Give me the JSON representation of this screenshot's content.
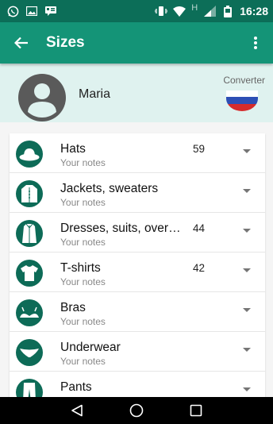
{
  "status_bar": {
    "time": "16:28",
    "network_label": "H",
    "icons": [
      "whatsapp-icon",
      "image-icon",
      "message-icon",
      "vibrate-icon",
      "wifi-icon",
      "signal-icon",
      "battery-icon"
    ]
  },
  "app_bar": {
    "title": "Sizes",
    "back_icon": "arrow-left-icon",
    "menu_icon": "more-vertical-icon"
  },
  "profile": {
    "name": "Maria",
    "converter_label": "Converter",
    "flag_icon": "russia-flag-icon"
  },
  "categories": [
    {
      "title": "Hats",
      "notes": "Your notes",
      "size": "59",
      "icon": "hat-icon"
    },
    {
      "title": "Jackets, sweaters",
      "notes": "Your notes",
      "size": "",
      "icon": "jacket-icon"
    },
    {
      "title": "Dresses, suits, over…",
      "notes": "Your notes",
      "size": "44",
      "icon": "coat-icon"
    },
    {
      "title": "T-shirts",
      "notes": "Your notes",
      "size": "42",
      "icon": "tshirt-icon"
    },
    {
      "title": "Bras",
      "notes": "Your notes",
      "size": "",
      "icon": "bra-icon"
    },
    {
      "title": "Underwear",
      "notes": "Your notes",
      "size": "",
      "icon": "underwear-icon"
    },
    {
      "title": "Pants",
      "notes": "",
      "size": "",
      "icon": "pants-icon"
    }
  ],
  "colors": {
    "status_bar": "#0c6e58",
    "app_bar": "#149477",
    "icon_circle": "#0d6b57",
    "profile_bg": "#dff2ef"
  }
}
